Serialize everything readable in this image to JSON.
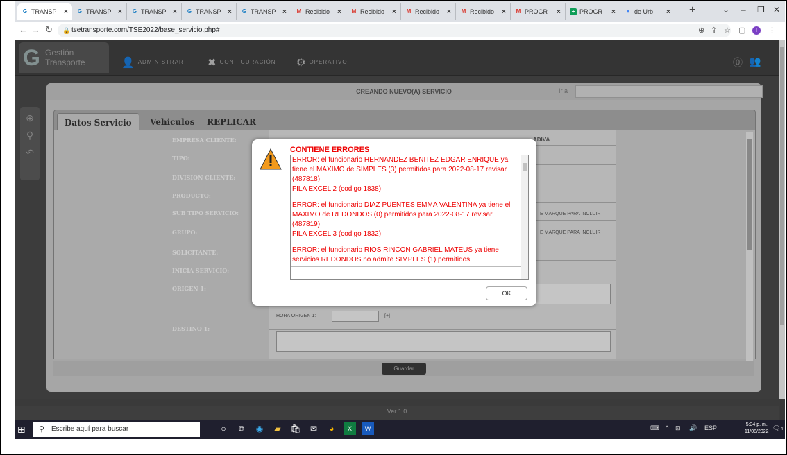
{
  "browser": {
    "tabs": [
      {
        "label": "TRANSP",
        "icon": "g-app-icon",
        "active": true
      },
      {
        "label": "TRANSP",
        "icon": "g-app-icon"
      },
      {
        "label": "TRANSP",
        "icon": "g-app-icon"
      },
      {
        "label": "TRANSP",
        "icon": "g-app-icon"
      },
      {
        "label": "TRANSP",
        "icon": "g-app-icon"
      },
      {
        "label": "Recibido",
        "icon": "gmail-icon"
      },
      {
        "label": "Recibido",
        "icon": "gmail-icon"
      },
      {
        "label": "Recibido",
        "icon": "gmail-icon"
      },
      {
        "label": "Recibido",
        "icon": "gmail-icon"
      },
      {
        "label": "PROGR",
        "icon": "gmail-icon"
      },
      {
        "label": "PROGR",
        "icon": "sheets-icon"
      },
      {
        "label": "de Urb",
        "icon": "maps-icon"
      }
    ],
    "url": "tsetransporte.com/TSE2022/base_servicio.php#",
    "profile_initial": "T"
  },
  "app": {
    "logo_line1": "Gestión",
    "logo_line2": "Transporte",
    "menu": [
      "ADMINISTRAR",
      "CONFIGURACIÓN",
      "OPERATIVO"
    ],
    "panel_title": "CREANDO NUEVO(A) SERVICIO",
    "ira_label": "Ir a",
    "tabs": [
      "Datos Servicio",
      "Vehiculos",
      "REPLICAR"
    ],
    "fields": [
      "EMPRESA CLIENTE:",
      "TIPO:",
      "DIVISION CLIENTE:",
      "PRODUCTO:",
      "SUB TIPO SERVICIO:",
      "GRUPO:",
      "SOLICITANTE:",
      "INICIA SERVICIO:",
      "ORIGEN 1:",
      "DESTINO 1:"
    ],
    "empresa_value_fragment": "ADIVA",
    "marque_hint": "E MARQUE PARA INCLUIR",
    "hora_origen_label": "HORA ORIGEN 1:",
    "hora_origen_icon": "[+]",
    "save_label": "Guardar",
    "version": "Ver 1.0"
  },
  "dialog": {
    "title": "CONTIENE ERRORES",
    "messages": [
      "ERROR: el funcionario HERNANDEZ BENITEZ EDGAR ENRIQUE ya tiene el MAXIMO de SIMPLES (3) permitidos para 2022-08-17 revisar (487818)\nFILA EXCEL 2 (codigo 1838)",
      "ERROR: el funcionario DIAZ PUENTES EMMA VALENTINA ya tiene el MAXIMO de REDONDOS (0) permitidos para 2022-08-17 revisar (487819)\nFILA EXCEL 3 (codigo 1832)",
      "ERROR: el funcionario RIOS RINCON GABRIEL MATEUS ya tiene servicios REDONDOS no admite SIMPLES (1) permitidos"
    ],
    "ok_label": "OK",
    "accent_color": "#ee0000"
  },
  "taskbar": {
    "search_placeholder": "Escribe aquí para buscar",
    "language": "ESP",
    "time": "5:34 p. m.",
    "date": "11/08/2022",
    "notification_count": "4"
  }
}
